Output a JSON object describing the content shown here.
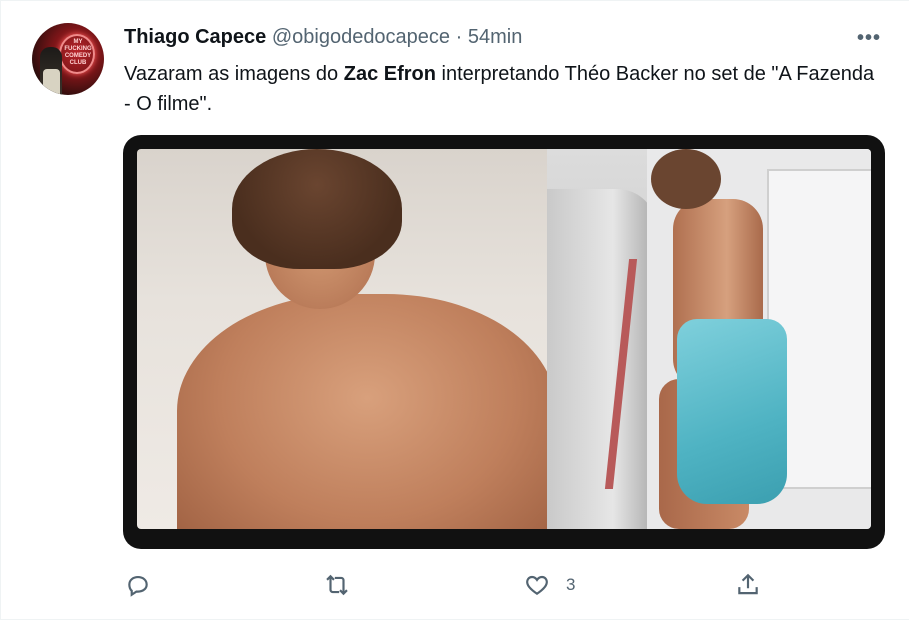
{
  "tweet": {
    "author_name": "Thiago Capece",
    "handle": "@obigodedocapece",
    "separator": "·",
    "time": "54min",
    "more": "•••",
    "text_part1": "Vazaram as imagens do ",
    "text_bold": "Zac Efron",
    "text_part2": " interpretando Théo Backer no set de \"A Fazenda - O filme\".",
    "avatar_text": "MY FUCKING COMEDY CLUB"
  },
  "actions": {
    "reply_icon": "reply-icon",
    "retweet_icon": "retweet-icon",
    "like_icon": "heart-icon",
    "like_count": "3",
    "share_icon": "share-icon"
  },
  "colors": {
    "text_primary": "#0f1419",
    "text_secondary": "#536471",
    "background": "#ffffff"
  }
}
